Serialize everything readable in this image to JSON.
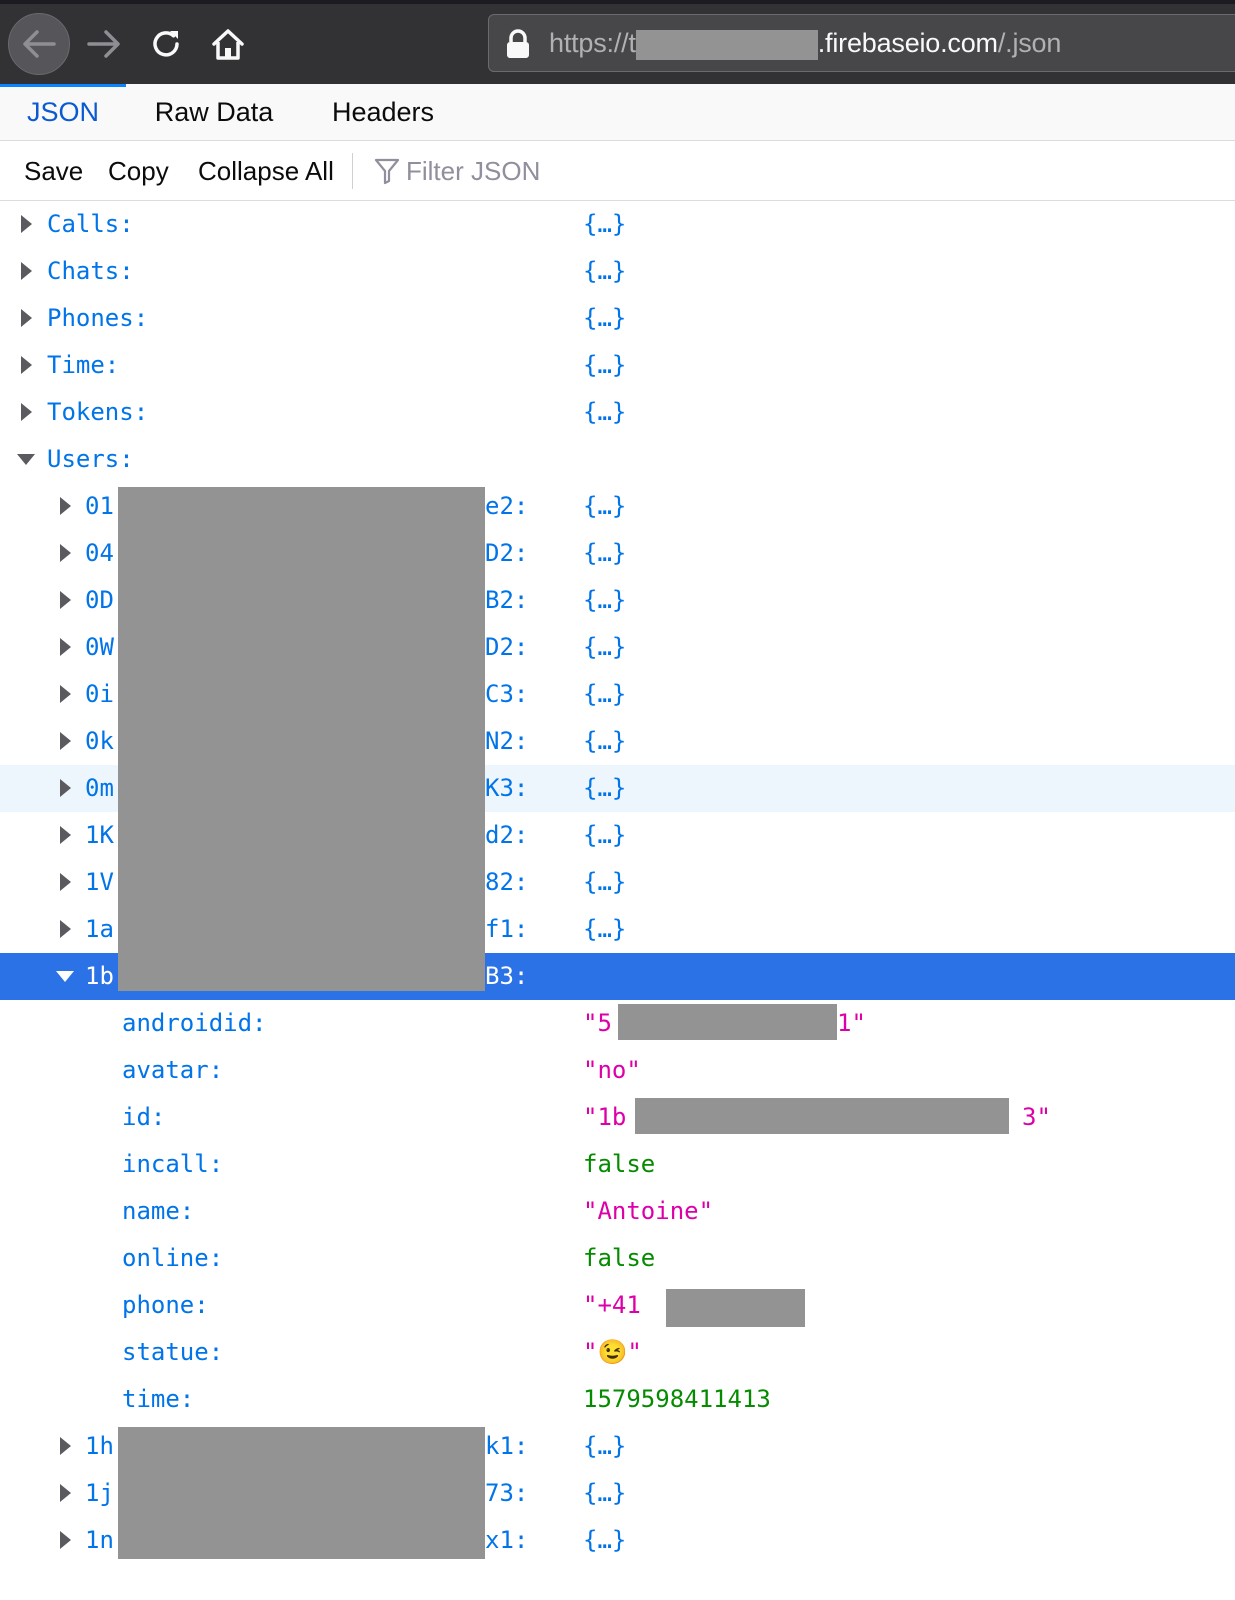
{
  "browser": {
    "url_prefix": "https://t",
    "url_host_suffix": ".firebaseio.com",
    "url_path": "/.json"
  },
  "tabs": [
    {
      "label": "JSON",
      "active": true
    },
    {
      "label": "Raw Data",
      "active": false
    },
    {
      "label": "Headers",
      "active": false
    }
  ],
  "json_toolbar": {
    "save_label": "Save",
    "copy_label": "Copy",
    "collapse_label": "Collapse All",
    "filter_placeholder": "Filter JSON"
  },
  "tree": {
    "collapsed_value": "{…}",
    "top_level": [
      {
        "key": "Calls:",
        "value": "{…}"
      },
      {
        "key": "Chats:",
        "value": "{…}"
      },
      {
        "key": "Phones:",
        "value": "{…}"
      },
      {
        "key": "Time:",
        "value": "{…}"
      },
      {
        "key": "Tokens:",
        "value": "{…}"
      },
      {
        "key": "Users:",
        "value": ""
      }
    ],
    "users": [
      {
        "key_start": "01",
        "key_end": "e2:",
        "value": "{…}"
      },
      {
        "key_start": "04",
        "key_end": "D2:",
        "value": "{…}"
      },
      {
        "key_start": "0D",
        "key_end": "B2:",
        "value": "{…}"
      },
      {
        "key_start": "0W",
        "key_end": "D2:",
        "value": "{…}"
      },
      {
        "key_start": "0i",
        "key_end": "C3:",
        "value": "{…}"
      },
      {
        "key_start": "0k",
        "key_end": "N2:",
        "value": "{…}"
      },
      {
        "key_start": "0m",
        "key_end": "K3:",
        "value": "{…}"
      },
      {
        "key_start": "1K",
        "key_end": "d2:",
        "value": "{…}"
      },
      {
        "key_start": "1V",
        "key_end": "82:",
        "value": "{…}"
      },
      {
        "key_start": "1a",
        "key_end": "f1:",
        "value": "{…}"
      },
      {
        "key_start": "1b",
        "key_end": "B3:",
        "value": ""
      }
    ],
    "selected_user_fields": [
      {
        "key": "androidid:",
        "value_start": "\"5",
        "value_end": "1\"",
        "type": "str"
      },
      {
        "key": "avatar:",
        "value": "\"no\"",
        "type": "str"
      },
      {
        "key": "id:",
        "value_start": "\"1b",
        "value_end": "3\"",
        "type": "str"
      },
      {
        "key": "incall:",
        "value": "false",
        "type": "bool"
      },
      {
        "key": "name:",
        "value": "\"Antoine\"",
        "type": "str"
      },
      {
        "key": "online:",
        "value": "false",
        "type": "bool"
      },
      {
        "key": "phone:",
        "value_start": "\"+41",
        "value_end": "",
        "type": "str"
      },
      {
        "key": "statue:",
        "value": "\"😉\"",
        "type": "str"
      },
      {
        "key": "time:",
        "value": "1579598411413",
        "type": "num"
      }
    ],
    "users_after": [
      {
        "key_start": "1h",
        "key_end": "k1:",
        "value": "{…}"
      },
      {
        "key_start": "1j",
        "key_end": "73:",
        "value": "{…}"
      },
      {
        "key_start": "1n",
        "key_end": "x1:",
        "value": "{…}"
      }
    ]
  },
  "colors": {
    "key": "#0074e8",
    "string": "#dd00a9",
    "boolean": "#058b00",
    "selected_row": "#2a72e6"
  }
}
